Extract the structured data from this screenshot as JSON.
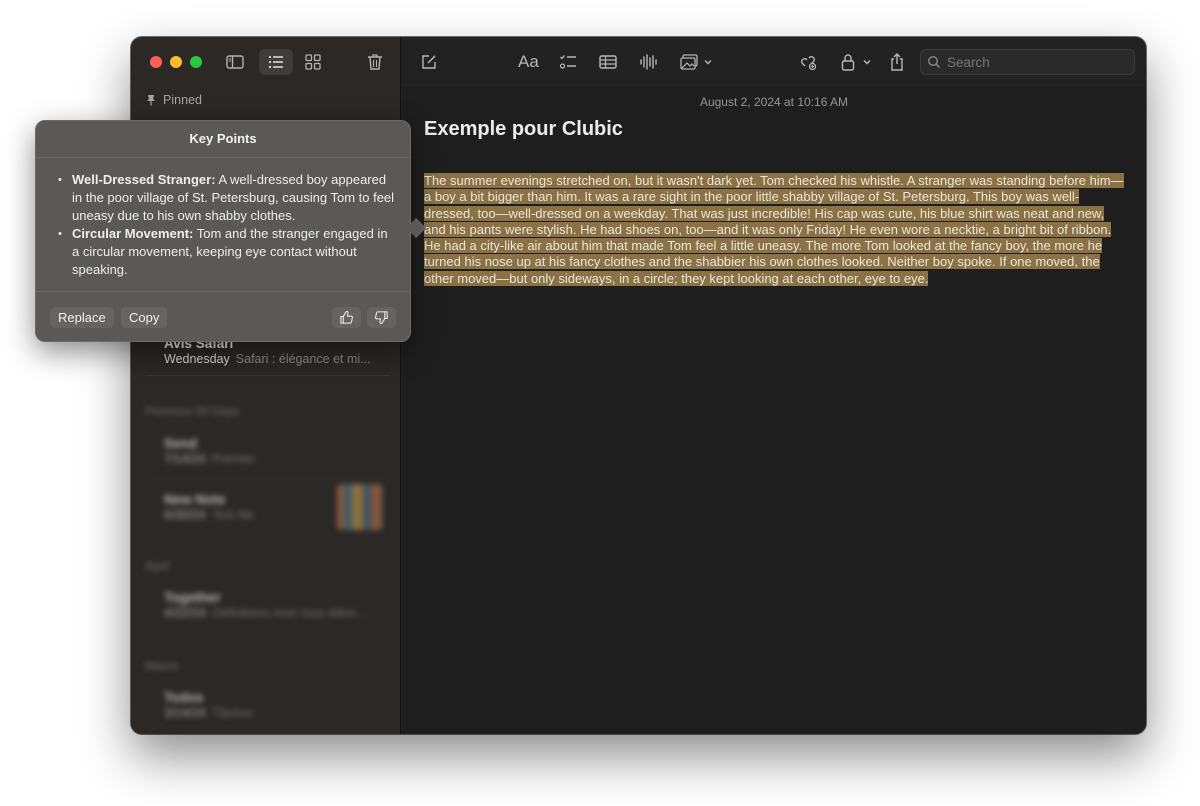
{
  "sidebar": {
    "pinned_label": "Pinned",
    "visible_note": {
      "title": "Avis Safari",
      "date": "Wednesday",
      "preview": "Safari : élégance et mi..."
    },
    "blurred_sections": [
      {
        "header": "Previous 30 Days",
        "notes": [
          {
            "title": "Send",
            "date": "7/14/24",
            "preview": "Premier"
          },
          {
            "title": "New Note",
            "date": "6/30/24",
            "preview": "Test file"
          }
        ]
      },
      {
        "header": "April",
        "notes": [
          {
            "title": "Together",
            "date": "4/22/24",
            "preview": "Définitions mon tous élém..."
          }
        ]
      },
      {
        "header": "March",
        "notes": [
          {
            "title": "Todos",
            "date": "3/14/24",
            "preview": "Tâches"
          }
        ]
      }
    ]
  },
  "toolbar": {
    "search_placeholder": "Search",
    "font_button_label": "Aa"
  },
  "note": {
    "timestamp": "August 2, 2024 at 10:16 AM",
    "title": "Exemple pour Clubic",
    "body": "The summer evenings stretched on, but it wasn't dark yet. Tom checked his whistle. A stranger was standing before him—a boy a bit bigger than him. It was a rare sight in the poor little shabby village of St. Petersburg. This boy was well-dressed, too—well-dressed on a weekday. That was just incredible! His cap was cute, his blue shirt was neat and new, and his pants were stylish. He had shoes on, too—and it was only Friday! He even wore a necktie, a bright bit of ribbon. He had a city-like air about him that made Tom feel a little uneasy. The more Tom looked at the fancy boy, the more he turned his nose up at his fancy clothes and the shabbier his own clothes looked. Neither boy spoke. If one moved, the other moved—but only sideways, in a circle; they kept looking at each other, eye to eye."
  },
  "popover": {
    "title": "Key Points",
    "points": [
      {
        "term": "Well-Dressed Stranger:",
        "text": " A well-dressed boy appeared in the poor village of St. Petersburg, causing Tom to feel uneasy due to his own shabby clothes."
      },
      {
        "term": "Circular Movement:",
        "text": " Tom and the stranger engaged in a circular movement, keeping eye contact without speaking."
      }
    ],
    "replace_label": "Replace",
    "copy_label": "Copy"
  },
  "colors": {
    "highlight": "#8a7246",
    "traffic_close": "#fe5f57",
    "traffic_min": "#febc2e",
    "traffic_max": "#28c840"
  }
}
